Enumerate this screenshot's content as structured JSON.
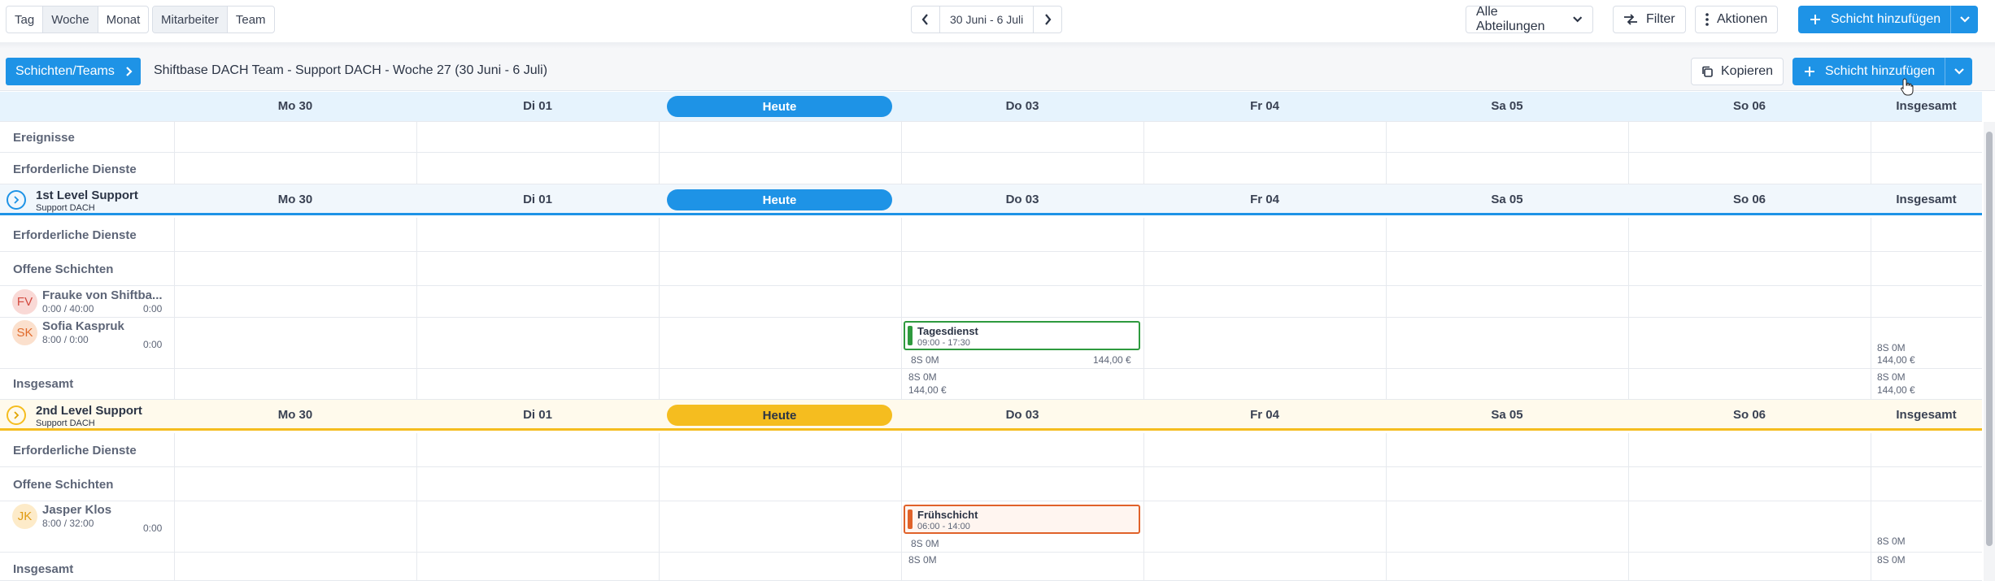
{
  "view_tabs": [
    "Tag",
    "Woche",
    "Monat"
  ],
  "group_tabs": [
    "Mitarbeiter",
    "Team"
  ],
  "date_range": "30 Juni - 6 Juli",
  "toolbar": {
    "department": "Alle Abteilungen",
    "filter": "Filter",
    "actions": "Aktionen",
    "add_shift": "Schicht hinzufügen"
  },
  "subheader": {
    "crumb": "Schichten/Teams",
    "title": "Shiftbase DACH Team - Support DACH - Woche 27 (30 Juni - 6 Juli)",
    "copy": "Kopieren",
    "add_shift": "Schicht hinzufügen"
  },
  "days": [
    "Mo 30",
    "Di 01",
    "Heute",
    "Do 03",
    "Fr 04",
    "Sa 05",
    "So 06",
    "Insgesamt"
  ],
  "rows": {
    "events": "Ereignisse",
    "required": "Erforderliche Dienste",
    "open": "Offene Schichten",
    "total": "Insgesamt"
  },
  "teams": [
    {
      "name": "1st Level Support",
      "sub": "Support DACH",
      "accent": "#1e93e6",
      "employees": [
        {
          "initials": "FV",
          "name": "Frauke von Shiftba...",
          "hours": "0:00 / 40:00",
          "value": "0:00"
        },
        {
          "initials": "SK",
          "name": "Sofia Kaspruk",
          "hours": "8:00 / 0:00",
          "value": "0:00"
        }
      ],
      "shift": {
        "name": "Tagesdienst",
        "time": "09:00 - 17:30",
        "meta": "8S 0M",
        "cost": "144,00 €"
      },
      "row_total": {
        "meta": "8S 0M",
        "cost": "144,00 €"
      },
      "day_total": {
        "meta": "8S 0M",
        "cost": "144,00 €"
      },
      "grand_total": {
        "meta": "8S 0M",
        "cost": "144,00 €"
      }
    },
    {
      "name": "2nd Level Support",
      "sub": "Support DACH",
      "accent": "#f5bd1f",
      "employees": [
        {
          "initials": "JK",
          "name": "Jasper Klos",
          "hours": "8:00 / 32:00",
          "value": "0:00"
        }
      ],
      "shift": {
        "name": "Frühschicht",
        "time": "06:00 - 14:00",
        "meta": "8S 0M"
      },
      "row_total": {
        "meta": "8S 0M"
      },
      "day_total": {
        "meta": "8S 0M"
      },
      "grand_total": {
        "meta": "8S 0M"
      }
    }
  ],
  "colors": {
    "primary": "#1e93e6",
    "team2": "#f5bd1f",
    "shift_green": "#2e9a3e",
    "shift_orange": "#e0622a"
  }
}
